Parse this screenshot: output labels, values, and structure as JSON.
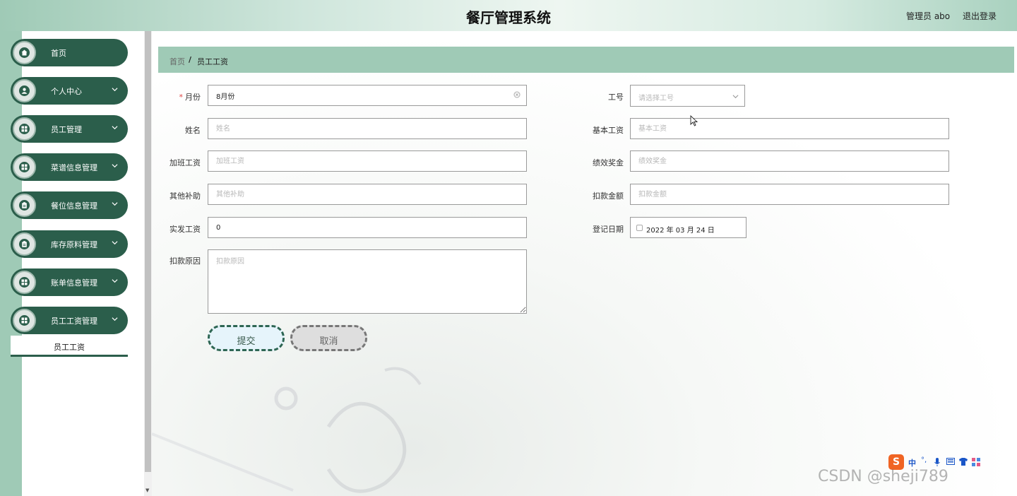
{
  "header": {
    "title": "餐厅管理系统",
    "user": "管理员 abo",
    "logout": "退出登录"
  },
  "sidebar": {
    "items": [
      {
        "label": "首页",
        "icon": "home-icon",
        "expandable": false
      },
      {
        "label": "个人中心",
        "icon": "user-icon",
        "expandable": true
      },
      {
        "label": "员工管理",
        "icon": "grid-icon",
        "expandable": true
      },
      {
        "label": "菜谱信息管理",
        "icon": "grid-icon",
        "expandable": true
      },
      {
        "label": "餐位信息管理",
        "icon": "clipboard-icon",
        "expandable": true
      },
      {
        "label": "库存原料管理",
        "icon": "clipboard-icon",
        "expandable": true
      },
      {
        "label": "账单信息管理",
        "icon": "grid-icon",
        "expandable": true
      },
      {
        "label": "员工工资管理",
        "icon": "grid-icon",
        "expandable": true
      }
    ],
    "submenu": {
      "label": "员工工资"
    }
  },
  "breadcrumb": {
    "home": "首页",
    "separator": "/",
    "current": "员工工资"
  },
  "form": {
    "month": {
      "label": "月份",
      "value": "8月份"
    },
    "emp_no": {
      "label": "工号",
      "placeholder": "请选择工号"
    },
    "name": {
      "label": "姓名",
      "placeholder": "姓名"
    },
    "base_salary": {
      "label": "基本工资",
      "placeholder": "基本工资"
    },
    "overtime": {
      "label": "加班工资",
      "placeholder": "加班工资"
    },
    "bonus": {
      "label": "绩效奖金",
      "placeholder": "绩效奖金"
    },
    "allowance": {
      "label": "其他补助",
      "placeholder": "其他补助"
    },
    "deduction": {
      "label": "扣款金额",
      "placeholder": "扣款金额"
    },
    "net_pay": {
      "label": "实发工资",
      "value": "0"
    },
    "reg_date": {
      "label": "登记日期",
      "value": "2022 年 03 月 24 日"
    },
    "deduct_reason": {
      "label": "扣款原因",
      "placeholder": "扣款原因"
    },
    "submit_label": "提交",
    "cancel_label": "取消"
  },
  "ime": {
    "brand": "S",
    "items": [
      "中",
      "°,",
      "mic",
      "kbd",
      "shirt",
      "grid"
    ]
  },
  "watermark": "CSDN @sheji789",
  "colors": {
    "primary": "#2b5e4b",
    "accent": "#9fcab6",
    "required": "#e04545"
  }
}
